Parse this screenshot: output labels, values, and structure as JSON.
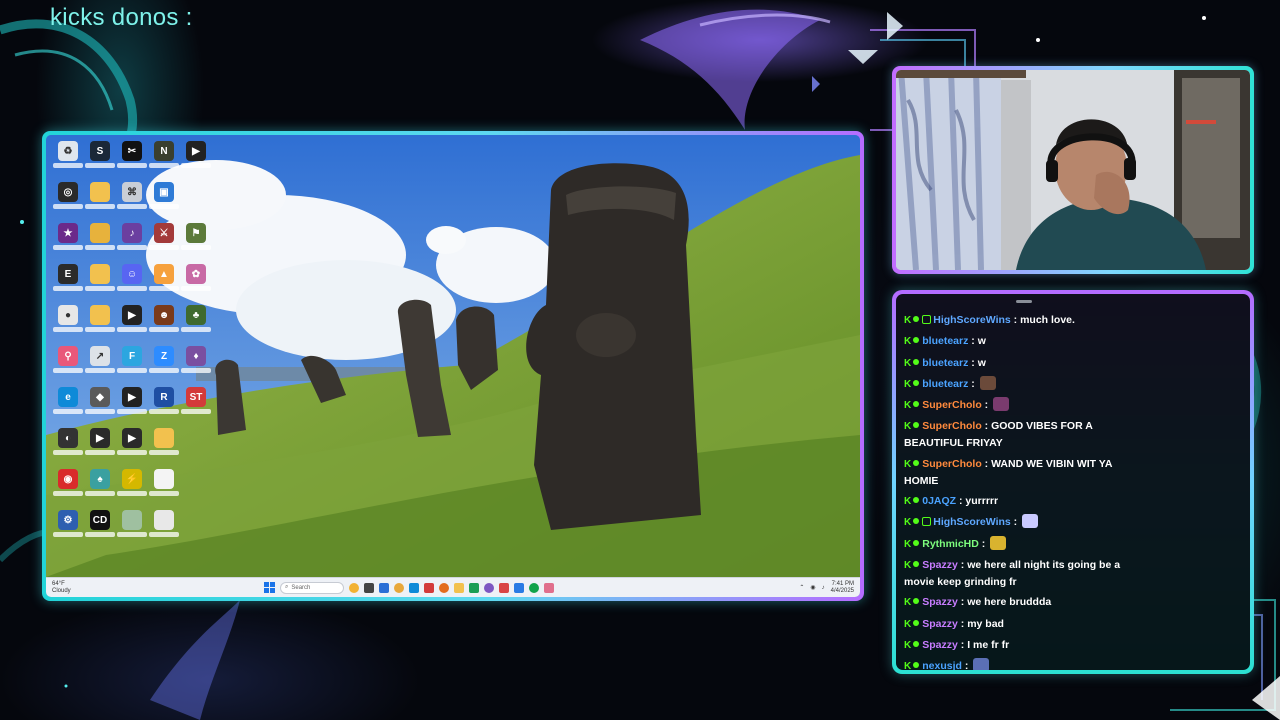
{
  "overlay": {
    "donos_title": "kicks donos :"
  },
  "desktop": {
    "icons": [
      {
        "name": "recycle-bin-icon",
        "color": "#dfe6ee",
        "glyph": "♻"
      },
      {
        "name": "steam-icon",
        "color": "#1b2838",
        "glyph": "S"
      },
      {
        "name": "capcut-icon",
        "color": "#111111",
        "glyph": "✂"
      },
      {
        "name": "nvidia-app-icon",
        "color": "#3a3f2e",
        "glyph": "N"
      },
      {
        "name": "streamlabs-icon",
        "color": "#222222",
        "glyph": "▶"
      },
      {
        "name": "obs-icon",
        "color": "#2a2a2a",
        "glyph": "◎"
      },
      {
        "name": "folder-icon",
        "color": "#f2c14e",
        "glyph": ""
      },
      {
        "name": "shortcut-icon",
        "color": "#c9ced6",
        "glyph": "⌘"
      },
      {
        "name": "window-app-icon",
        "color": "#2f7bd6",
        "glyph": "▣"
      },
      {
        "name": "blank-slot",
        "color": "transparent",
        "glyph": ""
      },
      {
        "name": "game-icon",
        "color": "#6b2a8a",
        "glyph": "★"
      },
      {
        "name": "folder-icon",
        "color": "#e7b23c",
        "glyph": ""
      },
      {
        "name": "purple-app-icon",
        "color": "#6b3fa0",
        "glyph": "♪"
      },
      {
        "name": "game-icon",
        "color": "#a33a3a",
        "glyph": "⚔"
      },
      {
        "name": "game-icon",
        "color": "#5c7a3a",
        "glyph": "⚑"
      },
      {
        "name": "epic-games-icon",
        "color": "#2b2b2b",
        "glyph": "E"
      },
      {
        "name": "folder-icon",
        "color": "#f2c14e",
        "glyph": ""
      },
      {
        "name": "discord-icon",
        "color": "#5865f2",
        "glyph": "☺"
      },
      {
        "name": "paint-app-icon",
        "color": "#f6a13d",
        "glyph": "▲"
      },
      {
        "name": "game-icon",
        "color": "#c86aa5",
        "glyph": "✿"
      },
      {
        "name": "chrome-icon",
        "color": "#e7e7e7",
        "glyph": "●"
      },
      {
        "name": "folder-icon",
        "color": "#f2c14e",
        "glyph": ""
      },
      {
        "name": "media-player-icon",
        "color": "#222222",
        "glyph": "▶"
      },
      {
        "name": "game-icon",
        "color": "#7a3a1a",
        "glyph": "☻"
      },
      {
        "name": "game-icon",
        "color": "#3f6a2f",
        "glyph": "♣"
      },
      {
        "name": "maps-icon",
        "color": "#e9587a",
        "glyph": "⚲"
      },
      {
        "name": "shortcut-icon",
        "color": "#dde2e8",
        "glyph": "↗"
      },
      {
        "name": "app-icon",
        "color": "#2ca6e0",
        "glyph": "F"
      },
      {
        "name": "zoom-icon",
        "color": "#2d8cff",
        "glyph": "Z"
      },
      {
        "name": "game-icon",
        "color": "#7a4fa0",
        "glyph": "♦"
      },
      {
        "name": "edge-icon",
        "color": "#0e8ad8",
        "glyph": "e"
      },
      {
        "name": "game-icon",
        "color": "#5a5a5a",
        "glyph": "◆"
      },
      {
        "name": "media-player-icon",
        "color": "#222222",
        "glyph": "▶"
      },
      {
        "name": "rocket-league-icon",
        "color": "#1f4fa3",
        "glyph": "R"
      },
      {
        "name": "supermarket-game-icon",
        "color": "#d33a3a",
        "glyph": "ST"
      },
      {
        "name": "app-icon",
        "color": "#333333",
        "glyph": "◐"
      },
      {
        "name": "media-player-icon",
        "color": "#2a2a2a",
        "glyph": "▶"
      },
      {
        "name": "media-player-icon",
        "color": "#2a2a2a",
        "glyph": "▶"
      },
      {
        "name": "folder-icon",
        "color": "#f2c14e",
        "glyph": ""
      },
      {
        "name": "blank-slot",
        "color": "transparent",
        "glyph": ""
      },
      {
        "name": "app-icon",
        "color": "#d92b2b",
        "glyph": "◉"
      },
      {
        "name": "game-icon",
        "color": "#3aa0a0",
        "glyph": "♠"
      },
      {
        "name": "game-icon",
        "color": "#d4b800",
        "glyph": "⚡"
      },
      {
        "name": "file-icon",
        "color": "#f4f4f4",
        "glyph": ""
      },
      {
        "name": "blank-slot",
        "color": "transparent",
        "glyph": ""
      },
      {
        "name": "app-icon",
        "color": "#2d5fb0",
        "glyph": "⚙"
      },
      {
        "name": "call-of-duty-icon",
        "color": "#111111",
        "glyph": "CD"
      },
      {
        "name": "image-file-icon",
        "color": "#9fc0a0",
        "glyph": ""
      },
      {
        "name": "file-icon",
        "color": "#e8e8e8",
        "glyph": ""
      },
      {
        "name": "blank-slot",
        "color": "transparent",
        "glyph": ""
      }
    ],
    "taskbar": {
      "weather_line1": "64°F",
      "weather_line2": "Cloudy",
      "search_placeholder": "Search",
      "time": "7:41 PM",
      "date": "4/4/2025",
      "apps": [
        "#f2b233",
        "#444444",
        "#2b6fd6",
        "#e8a73a",
        "#0e8ad8",
        "#d33a3a",
        "#e36c1d",
        "#f2c14e",
        "#1b9e55",
        "#7e57c2",
        "#d94545",
        "#2a7be4",
        "#11a34a",
        "#e06f8c"
      ]
    }
  },
  "chat": {
    "messages": [
      {
        "user": "HighScoreWins",
        "color": "#5fa8ff",
        "extra_badge": true,
        "text": "much love.",
        "emote": null
      },
      {
        "user": "bluetearz",
        "color": "#4ba3ff",
        "extra_badge": false,
        "text": "w",
        "emote": null
      },
      {
        "user": "bluetearz",
        "color": "#4ba3ff",
        "extra_badge": false,
        "text": "w",
        "emote": null
      },
      {
        "user": "bluetearz",
        "color": "#4ba3ff",
        "extra_badge": false,
        "text": "",
        "emote": "#6b4a3a"
      },
      {
        "user": "SuperCholo",
        "color": "#ff8a3d",
        "extra_badge": false,
        "text": "",
        "emote": "#7a3b6e"
      },
      {
        "user": "SuperCholo",
        "color": "#ff8a3d",
        "extra_badge": false,
        "text": "GOOD VIBES FOR A BEAUTIFUL FRIYAY",
        "emote": null
      },
      {
        "user": "SuperCholo",
        "color": "#ff8a3d",
        "extra_badge": false,
        "text": "WAND WE VIBIN WIT YA HOMIE",
        "emote": null
      },
      {
        "user": "0JAQZ",
        "color": "#4ba3ff",
        "extra_badge": false,
        "text": "yurrrrr",
        "emote": null
      },
      {
        "user": "HighScoreWins",
        "color": "#5fa8ff",
        "extra_badge": true,
        "text": "",
        "emote": "#c9c9ff"
      },
      {
        "user": "RythmicHD",
        "color": "#7dfc7d",
        "extra_badge": false,
        "text": "",
        "emote": "#d9b32f"
      },
      {
        "user": "Spazzy",
        "color": "#c77dff",
        "extra_badge": false,
        "text": "we here all night its going be a movie keep grinding fr",
        "emote": null
      },
      {
        "user": "Spazzy",
        "color": "#c77dff",
        "extra_badge": false,
        "text": "we here bruddda",
        "emote": null
      },
      {
        "user": "Spazzy",
        "color": "#c77dff",
        "extra_badge": false,
        "text": "my bad",
        "emote": null
      },
      {
        "user": "Spazzy",
        "color": "#c77dff",
        "extra_badge": false,
        "text": "I me fr fr",
        "emote": null
      },
      {
        "user": "nexusjd",
        "color": "#4ba3ff",
        "extra_badge": false,
        "text": "",
        "emote": "#5b6fb5"
      }
    ]
  }
}
